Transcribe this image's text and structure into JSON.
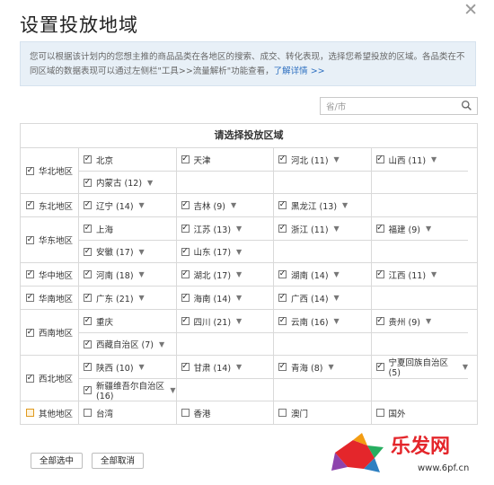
{
  "dialog": {
    "title": "设置投放地域",
    "close_icon": "close-icon",
    "info_text": "您可以根据该计划内的您想主推的商品品类在各地区的搜索、成交、转化表现，选择您希望投放的区域。各品类在不同区域的数据表现可以通过左侧栏\"工具>>流量解析\"功能查看，",
    "info_link": "了解详情 >>",
    "search_placeholder": "省/市",
    "grid_header": "请选择投放区域",
    "buttons": {
      "select_all": "全部选中",
      "cancel_all": "全部取消"
    }
  },
  "regions": [
    {
      "name": "华北地区",
      "checked": true,
      "lines": [
        [
          {
            "label": "北京",
            "checked": true,
            "caret": false
          },
          {
            "label": "天津",
            "checked": true,
            "caret": false
          },
          {
            "label": "河北 (11)",
            "checked": true,
            "caret": true
          },
          {
            "label": "山西 (11)",
            "checked": true,
            "caret": true
          }
        ],
        [
          {
            "label": "内蒙古 (12)",
            "checked": true,
            "caret": true
          }
        ]
      ]
    },
    {
      "name": "东北地区",
      "checked": true,
      "lines": [
        [
          {
            "label": "辽宁 (14)",
            "checked": true,
            "caret": true
          },
          {
            "label": "吉林 (9)",
            "checked": true,
            "caret": true
          },
          {
            "label": "黑龙江 (13)",
            "checked": true,
            "caret": true
          }
        ]
      ]
    },
    {
      "name": "华东地区",
      "checked": true,
      "lines": [
        [
          {
            "label": "上海",
            "checked": true,
            "caret": false
          },
          {
            "label": "江苏 (13)",
            "checked": true,
            "caret": true
          },
          {
            "label": "浙江 (11)",
            "checked": true,
            "caret": true
          },
          {
            "label": "福建 (9)",
            "checked": true,
            "caret": true
          }
        ],
        [
          {
            "label": "安徽 (17)",
            "checked": true,
            "caret": true
          },
          {
            "label": "山东 (17)",
            "checked": true,
            "caret": true
          }
        ]
      ]
    },
    {
      "name": "华中地区",
      "checked": true,
      "lines": [
        [
          {
            "label": "河南 (18)",
            "checked": true,
            "caret": true
          },
          {
            "label": "湖北 (17)",
            "checked": true,
            "caret": true
          },
          {
            "label": "湖南 (14)",
            "checked": true,
            "caret": true
          },
          {
            "label": "江西 (11)",
            "checked": true,
            "caret": true
          }
        ]
      ]
    },
    {
      "name": "华南地区",
      "checked": true,
      "lines": [
        [
          {
            "label": "广东 (21)",
            "checked": true,
            "caret": true
          },
          {
            "label": "海南 (14)",
            "checked": true,
            "caret": true
          },
          {
            "label": "广西 (14)",
            "checked": true,
            "caret": true
          }
        ]
      ]
    },
    {
      "name": "西南地区",
      "checked": true,
      "lines": [
        [
          {
            "label": "重庆",
            "checked": true,
            "caret": false
          },
          {
            "label": "四川 (21)",
            "checked": true,
            "caret": true
          },
          {
            "label": "云南 (16)",
            "checked": true,
            "caret": true
          },
          {
            "label": "贵州 (9)",
            "checked": true,
            "caret": true
          }
        ],
        [
          {
            "label": "西藏自治区 (7)",
            "checked": true,
            "caret": true
          }
        ]
      ]
    },
    {
      "name": "西北地区",
      "checked": true,
      "lines": [
        [
          {
            "label": "陕西 (10)",
            "checked": true,
            "caret": true
          },
          {
            "label": "甘肃 (14)",
            "checked": true,
            "caret": true
          },
          {
            "label": "青海 (8)",
            "checked": true,
            "caret": true
          },
          {
            "label": "宁夏回族自治区 (5)",
            "checked": true,
            "caret": true
          }
        ],
        [
          {
            "label": "新疆维吾尔自治区 (16)",
            "checked": true,
            "caret": true
          }
        ]
      ]
    },
    {
      "name": "其他地区",
      "checked": false,
      "partial": true,
      "lines": [
        [
          {
            "label": "台湾",
            "checked": false,
            "caret": false
          },
          {
            "label": "香港",
            "checked": false,
            "caret": false
          },
          {
            "label": "澳门",
            "checked": false,
            "caret": false
          },
          {
            "label": "国外",
            "checked": false,
            "caret": false
          }
        ]
      ]
    }
  ],
  "watermark": {
    "text": "乐发网",
    "url": "www.6pf.cn",
    "colors": [
      "#e4262b",
      "#f39c12",
      "#2d7fc1",
      "#8e44ad"
    ]
  }
}
